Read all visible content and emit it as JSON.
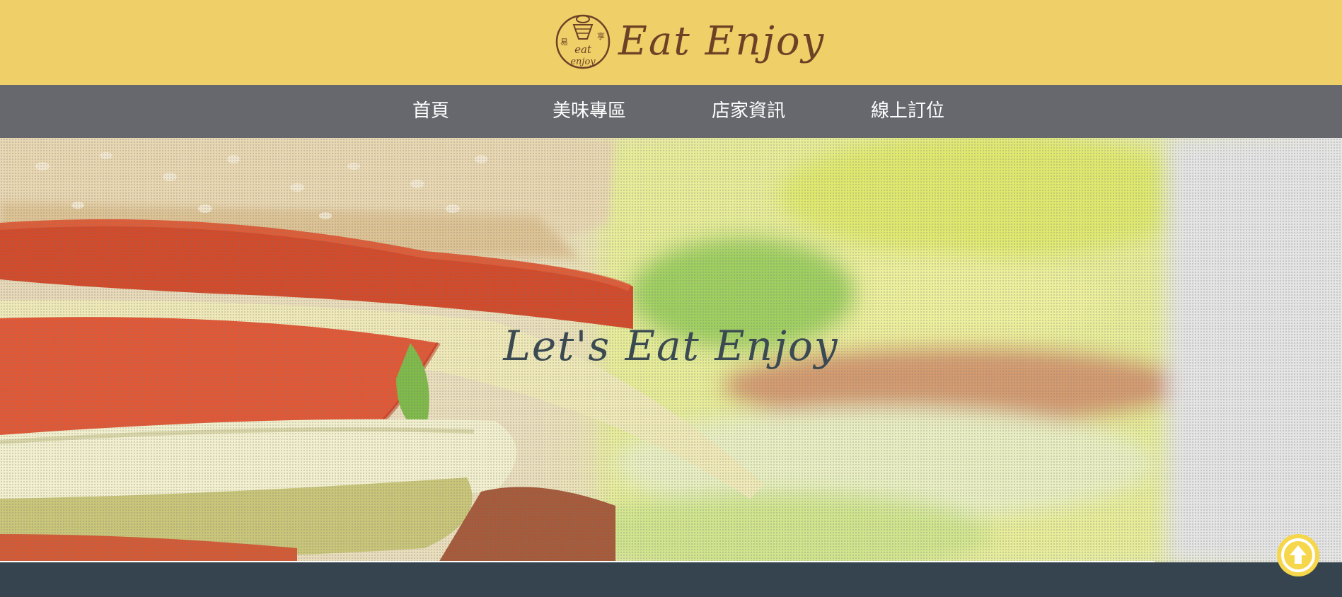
{
  "header": {
    "logo_text": "Eat Enjoy",
    "logo_mark_text": [
      "易享",
      "eat",
      "enjoy"
    ],
    "background_color": "#eecf68",
    "text_color": "#6b4226"
  },
  "nav": {
    "background_color": "#67686e",
    "items": [
      {
        "label": "首頁"
      },
      {
        "label": "美味專區"
      },
      {
        "label": "店家資訊"
      },
      {
        "label": "線上訂位"
      }
    ]
  },
  "hero": {
    "title": "Let's Eat Enjoy",
    "image_subject": "sandwich-closeup",
    "title_color": "#3b4a52"
  },
  "footer": {
    "background_color": "#35444e"
  },
  "back_to_top": {
    "icon": "arrow-up-icon",
    "color": "#f6d64a"
  }
}
